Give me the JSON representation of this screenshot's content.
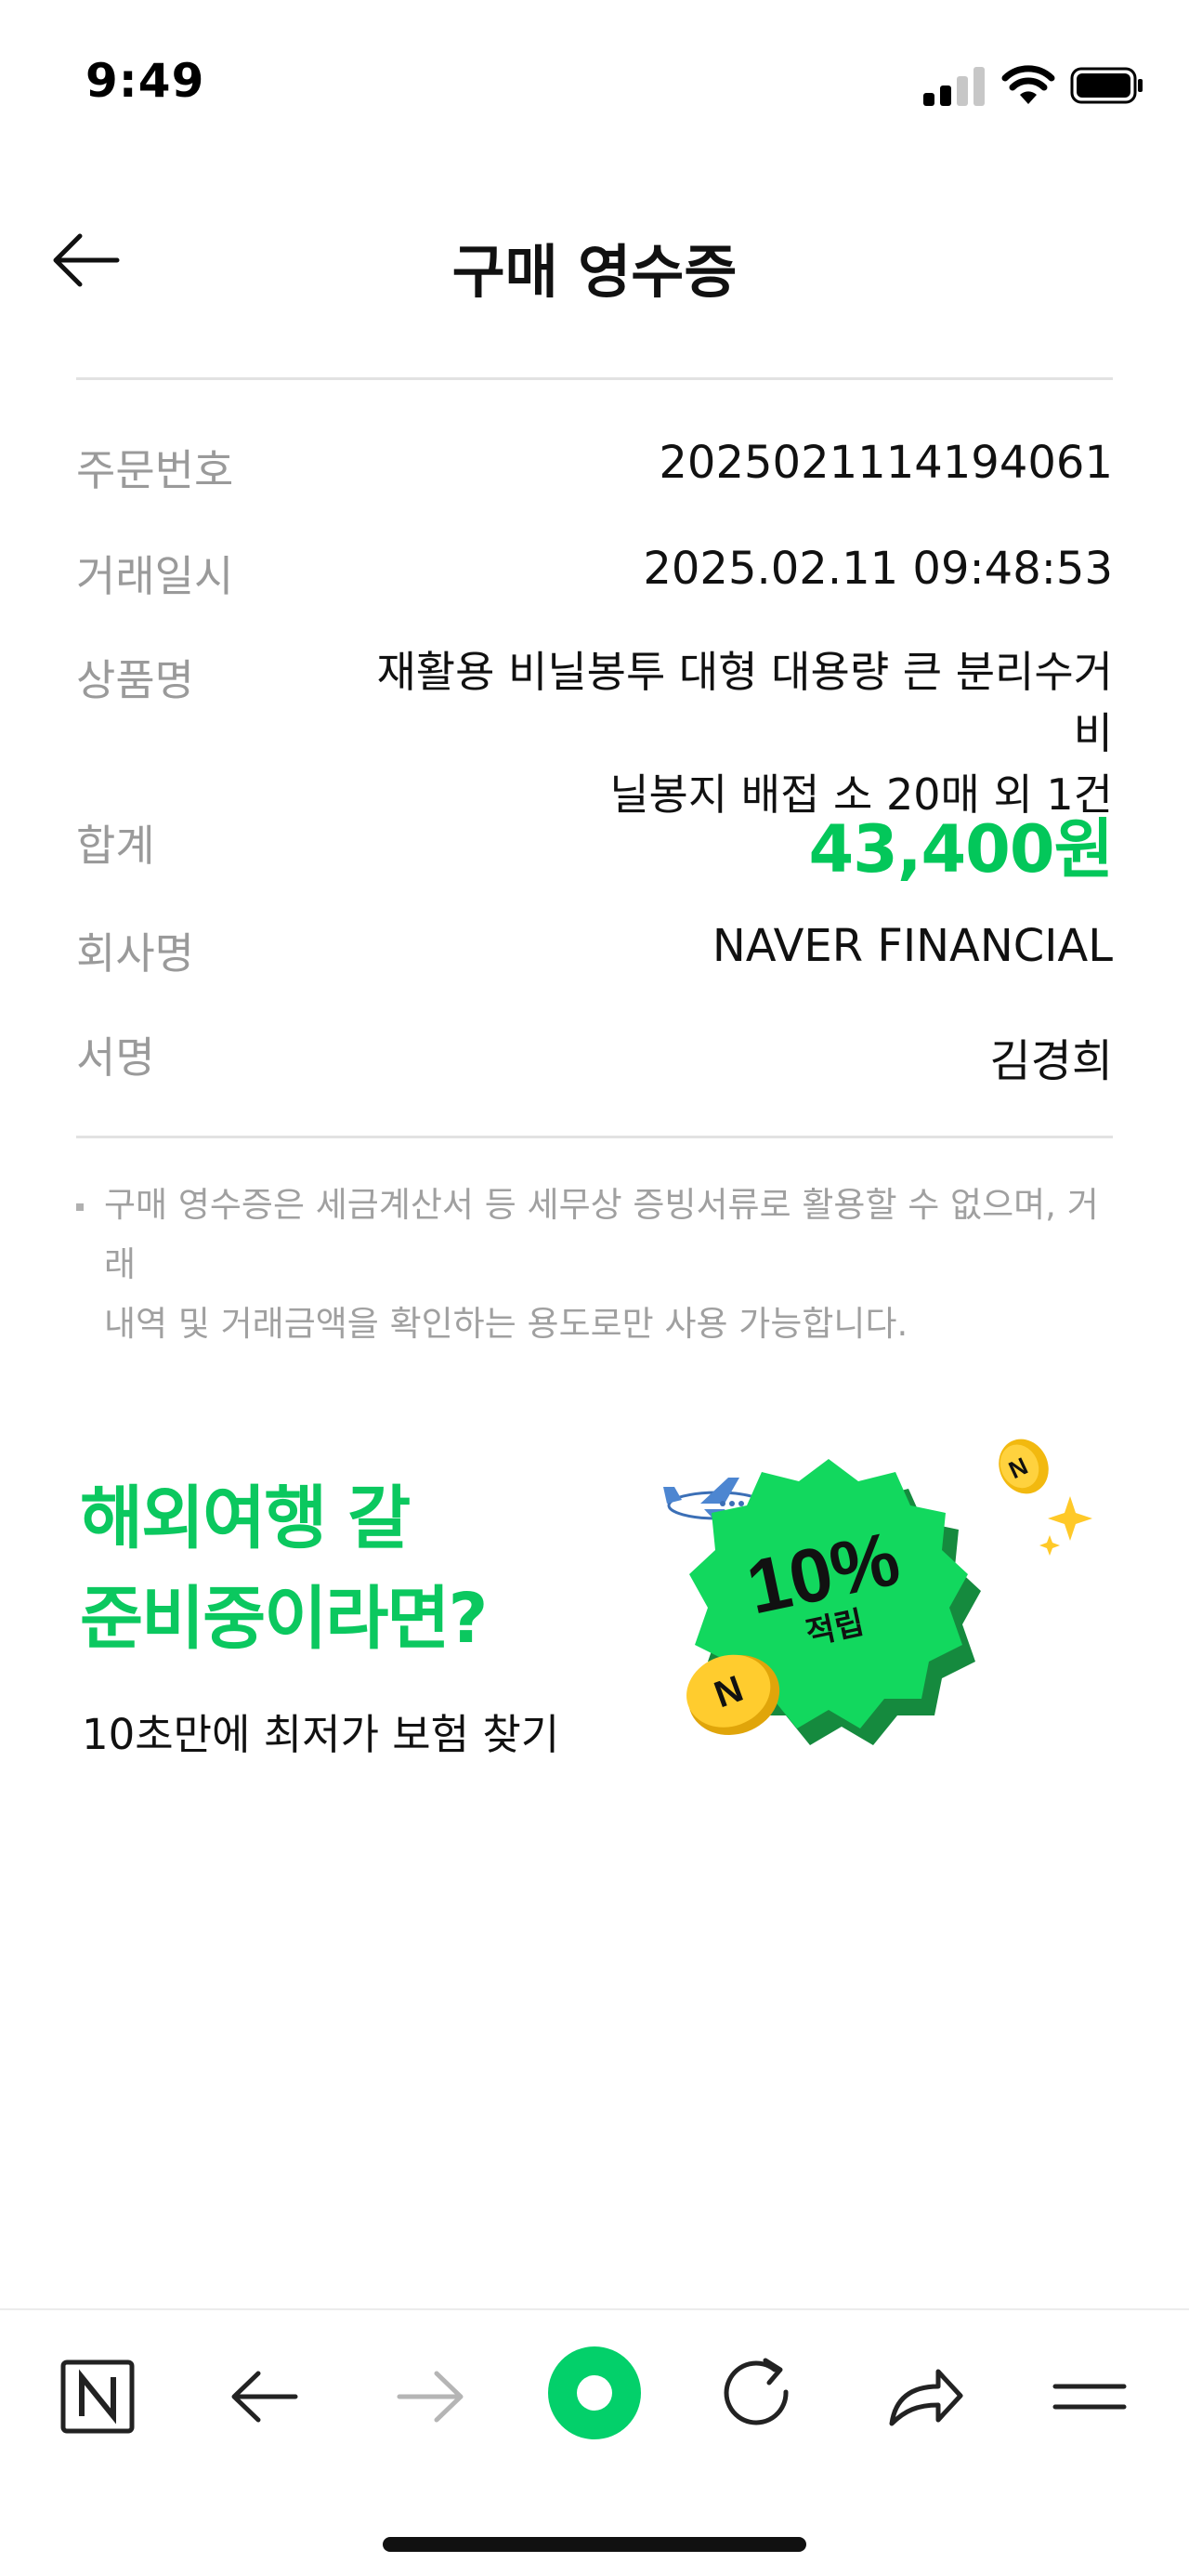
{
  "status_bar": {
    "time": "9:49"
  },
  "header": {
    "title": "구매 영수증"
  },
  "receipt": [
    {
      "label": "주문번호",
      "value": "2025021114194061"
    },
    {
      "label": "거래일시",
      "value": "2025.02.11 09:48:53"
    },
    {
      "label": "상품명",
      "value_line1": "재활용 비닐봉투 대형 대용량 큰 분리수거 비",
      "value_line2": "닐봉지 배접 소 20매 외 1건"
    },
    {
      "label": "합계",
      "value": "43,400원"
    },
    {
      "label": "회사명",
      "value": "NAVER FINANCIAL"
    },
    {
      "label": "서명",
      "value": "김경희"
    }
  ],
  "notice": {
    "line1": "구매 영수증은 세금계산서 등 세무상 증빙서류로 활용할 수 없으며, 거래",
    "line2": "내역 및 거래금액을 확인하는 용도로만 사용 가능합니다."
  },
  "banner": {
    "title_line1": "해외여행 갈",
    "title_line2": "준비중이라면?",
    "subtitle": "10초만에 최저가 보험 찾기",
    "badge_percent": "10%",
    "badge_label": "적립"
  },
  "toolbar": {
    "icons": [
      "naver-home-icon",
      "back-icon",
      "forward-icon",
      "green-dot-icon",
      "refresh-icon",
      "share-icon",
      "menu-icon"
    ]
  },
  "colors": {
    "accent": "#03c75a",
    "label": "#9a9a9a",
    "text": "#111111"
  }
}
